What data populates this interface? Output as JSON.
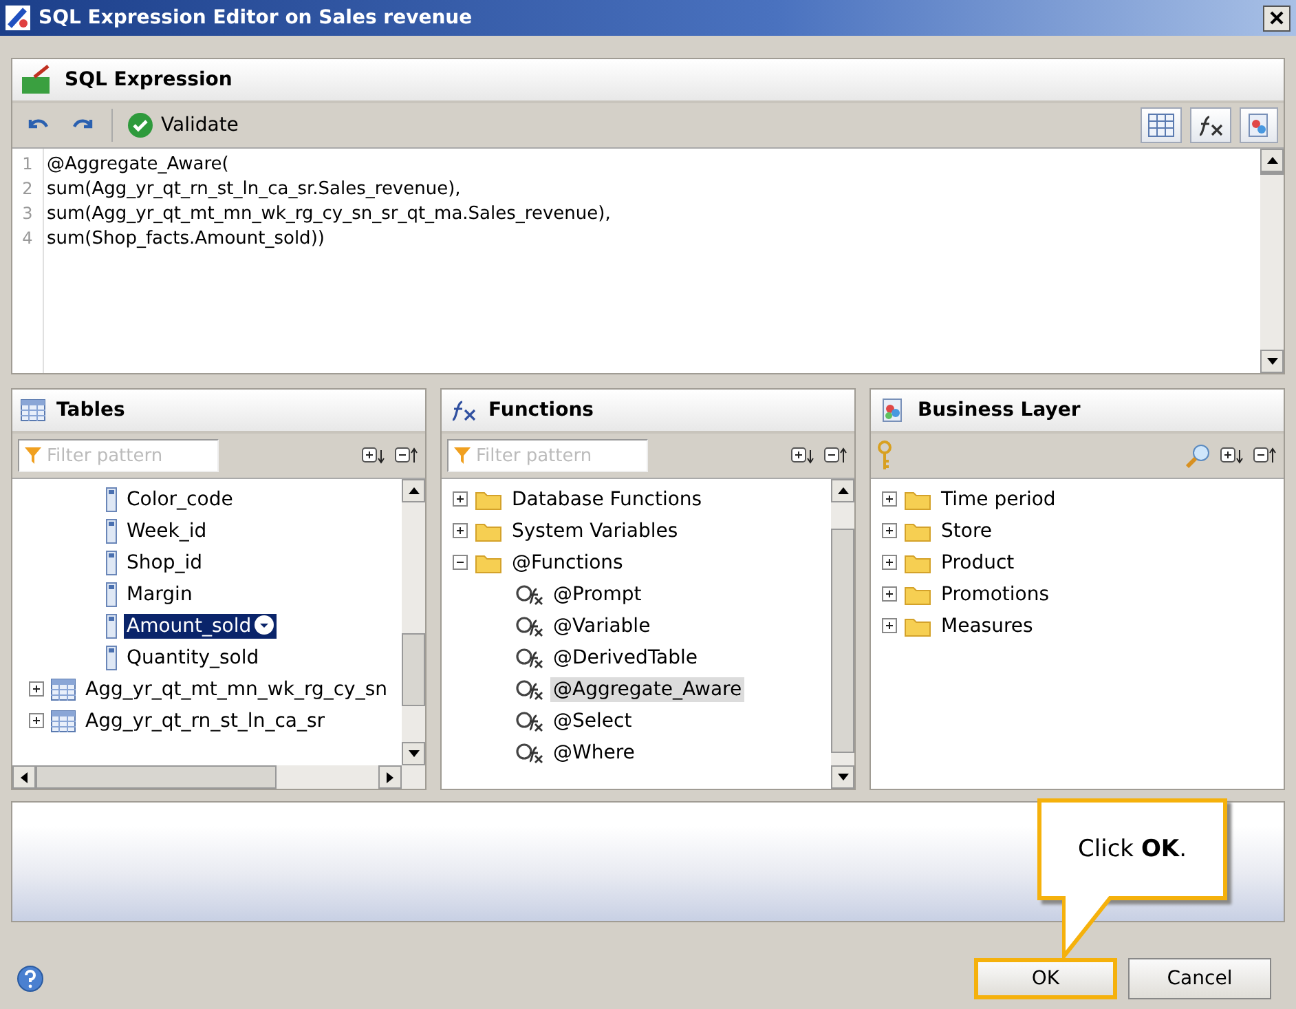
{
  "window": {
    "title": "SQL Expression Editor on Sales revenue"
  },
  "expression": {
    "title": "SQL Expression",
    "validate": "Validate",
    "lines": [
      {
        "number": "1",
        "text": "@Aggregate_Aware("
      },
      {
        "number": "2",
        "text": "sum(Agg_yr_qt_rn_st_ln_ca_sr.Sales_revenue),"
      },
      {
        "number": "3",
        "text": "sum(Agg_yr_qt_mt_mn_wk_rg_cy_sn_sr_qt_ma.Sales_revenue),"
      },
      {
        "number": "4",
        "text": "sum(Shop_facts.Amount_sold))"
      }
    ]
  },
  "tables": {
    "title": "Tables",
    "placeholder": "Filter pattern",
    "items": [
      {
        "kind": "column",
        "label": "Color_code",
        "selected": false
      },
      {
        "kind": "column",
        "label": "Week_id",
        "selected": false
      },
      {
        "kind": "column",
        "label": "Shop_id",
        "selected": false
      },
      {
        "kind": "column",
        "label": "Margin",
        "selected": false
      },
      {
        "kind": "column",
        "label": "Amount_sold",
        "selected": true
      },
      {
        "kind": "column",
        "label": "Quantity_sold",
        "selected": false
      },
      {
        "kind": "table",
        "label": "Agg_yr_qt_mt_mn_wk_rg_cy_sn",
        "selected": false,
        "expanded": false
      },
      {
        "kind": "table",
        "label": "Agg_yr_qt_rn_st_ln_ca_sr",
        "selected": false,
        "expanded": false
      }
    ]
  },
  "functions": {
    "title": "Functions",
    "placeholder": "Filter pattern",
    "items": [
      {
        "label": "Database Functions",
        "expanded": false,
        "selected": false
      },
      {
        "label": "System Variables",
        "expanded": false,
        "selected": false
      },
      {
        "label": "@Functions",
        "expanded": true,
        "selected": false,
        "children": [
          {
            "label": "@Prompt",
            "selected": false
          },
          {
            "label": "@Variable",
            "selected": false
          },
          {
            "label": "@DerivedTable",
            "selected": false
          },
          {
            "label": "@Aggregate_Aware",
            "selected": true
          },
          {
            "label": "@Select",
            "selected": false
          },
          {
            "label": "@Where",
            "selected": false
          }
        ]
      }
    ]
  },
  "business_layer": {
    "title": "Business Layer",
    "items": [
      {
        "label": "Time period",
        "expanded": false
      },
      {
        "label": "Store",
        "expanded": false
      },
      {
        "label": "Product",
        "expanded": false
      },
      {
        "label": "Promotions",
        "expanded": false
      },
      {
        "label": "Measures",
        "expanded": false
      }
    ]
  },
  "callout": {
    "text": "Click **OK**."
  },
  "buttons": [
    {
      "label": "OK",
      "highlighted": true
    },
    {
      "label": "Cancel",
      "highlighted": false
    }
  ]
}
